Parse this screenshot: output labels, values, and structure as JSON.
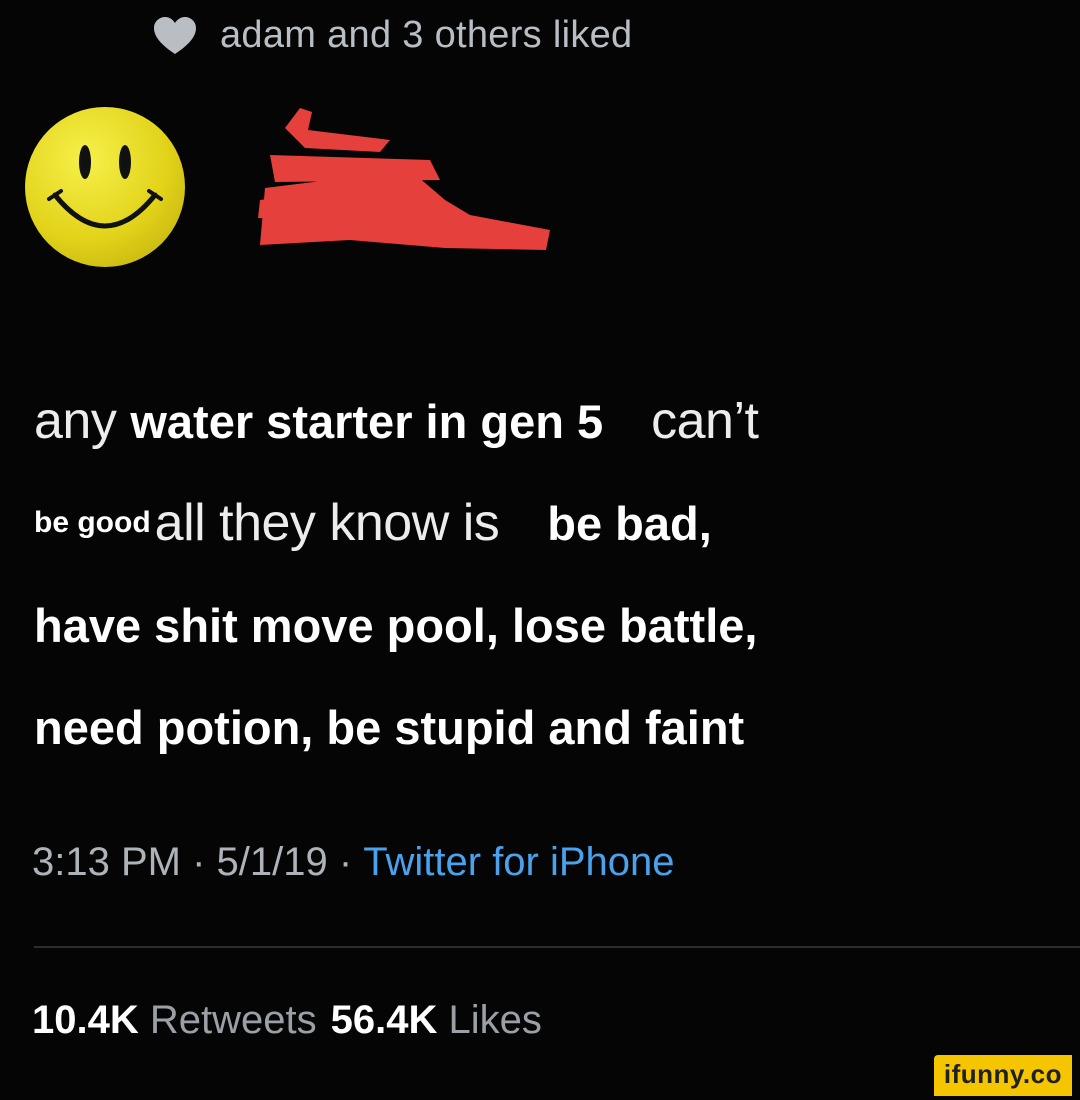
{
  "liked_bar": {
    "icon": "heart-icon",
    "text": "adam and 3 others liked"
  },
  "avatar": {
    "icon": "smiley-face-icon",
    "color": "#e2d31a"
  },
  "redaction": {
    "color": "#e5403c"
  },
  "tweet": {
    "line1": {
      "w1": "any",
      "w2": "water starter in gen 5",
      "w3": "can’t"
    },
    "line2": {
      "w1": "be good",
      "w2": "all they know is",
      "w3": "be bad,"
    },
    "line3": "have shit move pool, lose battle,",
    "line4": "need potion, be stupid  and faint"
  },
  "meta": {
    "time": "3:13 PM",
    "sep1": " · ",
    "date": "5/1/19",
    "sep2": " · ",
    "source": "Twitter for iPhone"
  },
  "stats": {
    "retweets_count": "10.4K",
    "retweets_label": "Retweets",
    "likes_count": "56.4K",
    "likes_label": "Likes"
  },
  "watermark": "ifunny.co"
}
